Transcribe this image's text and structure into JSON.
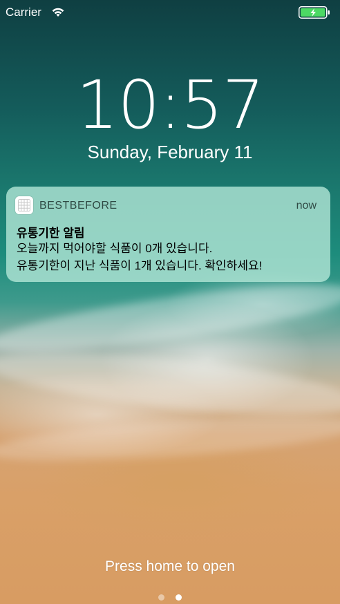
{
  "status_bar": {
    "carrier": "Carrier",
    "wifi_icon": "wifi-icon",
    "battery_icon": "battery-icon",
    "battery_color": "#4cd964"
  },
  "lock_screen": {
    "time": "10:57",
    "date": "Sunday, February 11",
    "hint": "Press home to open",
    "page_dots": [
      false,
      true
    ]
  },
  "notification": {
    "app_icon": "app-grid-icon",
    "app_name": "BESTBEFORE",
    "time": "now",
    "title": "유통기한 알림",
    "body_lines": [
      "오늘까지 먹어야할 식품이 0개 있습니다.",
      "유통기한이 지난 식품이 1개 있습니다. 확인하세요!"
    ],
    "background_color": "#b0e4d4"
  }
}
